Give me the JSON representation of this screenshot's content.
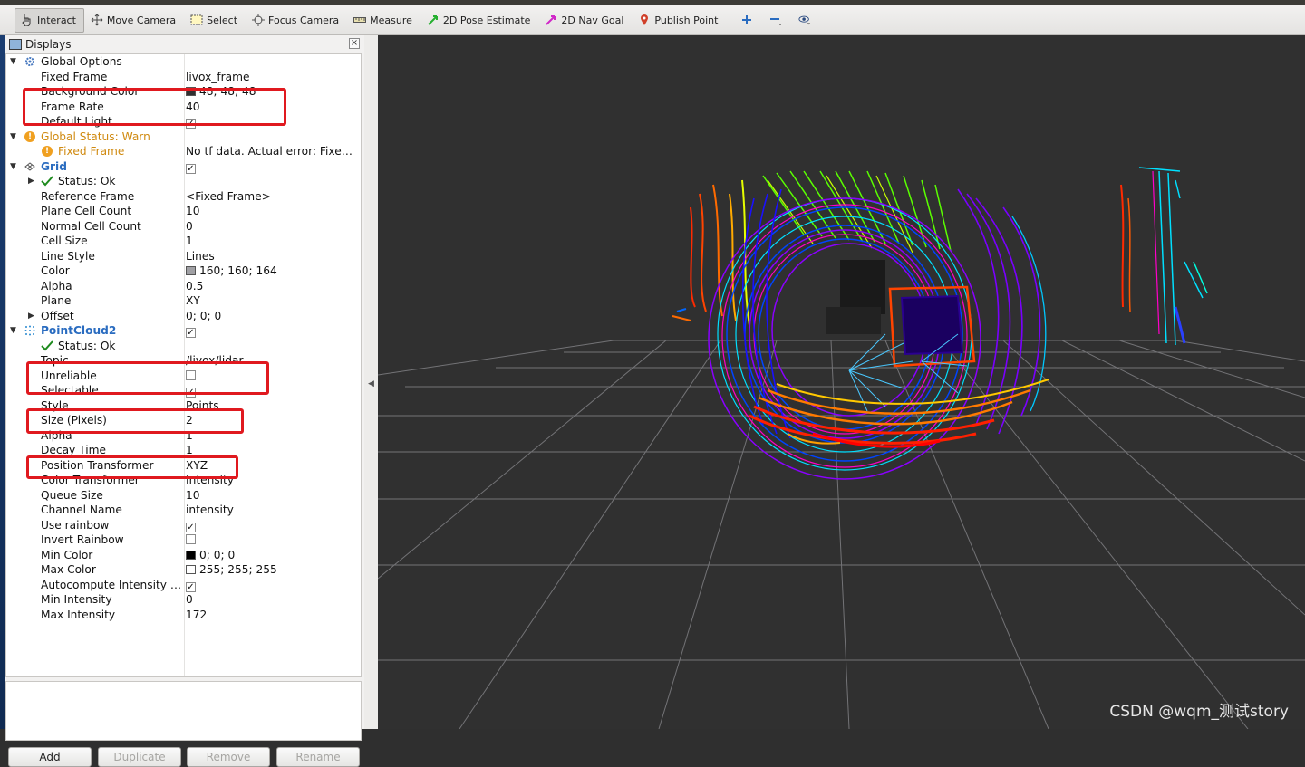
{
  "toolbar": {
    "tools": [
      {
        "label": "Interact",
        "icon": "cursor-hand-icon",
        "active": true
      },
      {
        "label": "Move Camera",
        "icon": "move-camera-icon"
      },
      {
        "label": "Select",
        "icon": "select-box-icon"
      },
      {
        "label": "Focus Camera",
        "icon": "focus-camera-icon"
      },
      {
        "label": "Measure",
        "icon": "ruler-icon"
      },
      {
        "label": "2D Pose Estimate",
        "icon": "green-arrow-icon"
      },
      {
        "label": "2D Nav Goal",
        "icon": "magenta-arrow-icon"
      },
      {
        "label": "Publish Point",
        "icon": "map-pin-icon"
      }
    ],
    "extra_icons": [
      "plus-cross-icon",
      "minus-icon",
      "eye-icon"
    ]
  },
  "displays_panel": {
    "title": "Displays",
    "close": "×"
  },
  "tree": {
    "global_options": {
      "label": "Global Options"
    },
    "fixed_frame": {
      "name": "Fixed Frame",
      "value": "livox_frame"
    },
    "background_color": {
      "name": "Background Color",
      "value": "48; 48; 48",
      "swatch": "#303030"
    },
    "frame_rate": {
      "name": "Frame Rate",
      "value": "40"
    },
    "default_light": {
      "name": "Default Light",
      "checked": "✓"
    },
    "global_status": {
      "label": "Global Status: Warn"
    },
    "gs_fixed_frame": {
      "name": "Fixed Frame",
      "value": "No tf data.  Actual error: Fixe…"
    },
    "grid": {
      "label": "Grid",
      "checked": "✓"
    },
    "grid_status": {
      "name": "Status: Ok"
    },
    "reference_frame": {
      "name": "Reference Frame",
      "value": "<Fixed Frame>"
    },
    "plane_cell_count": {
      "name": "Plane Cell Count",
      "value": "10"
    },
    "normal_cell_count": {
      "name": "Normal Cell Count",
      "value": "0"
    },
    "cell_size": {
      "name": "Cell Size",
      "value": "1"
    },
    "line_style": {
      "name": "Line Style",
      "value": "Lines"
    },
    "color": {
      "name": "Color",
      "value": "160; 160; 164",
      "swatch": "#a0a0a4"
    },
    "alpha": {
      "name": "Alpha",
      "value": "0.5"
    },
    "plane": {
      "name": "Plane",
      "value": "XY"
    },
    "offset": {
      "name": "Offset",
      "value": "0; 0; 0"
    },
    "pointcloud2": {
      "label": "PointCloud2",
      "checked": "✓"
    },
    "pc_status": {
      "name": "Status: Ok"
    },
    "topic": {
      "name": "Topic",
      "value": "/livox/lidar"
    },
    "unreliable": {
      "name": "Unreliable",
      "checked": ""
    },
    "selectable": {
      "name": "Selectable",
      "checked": "✓"
    },
    "style": {
      "name": "Style",
      "value": "Points"
    },
    "size_pixels": {
      "name": "Size (Pixels)",
      "value": "2"
    },
    "pc_alpha": {
      "name": "Alpha",
      "value": "1"
    },
    "decay_time": {
      "name": "Decay Time",
      "value": "1"
    },
    "position_transformer": {
      "name": "Position Transformer",
      "value": "XYZ"
    },
    "color_transformer": {
      "name": "Color Transformer",
      "value": "Intensity"
    },
    "queue_size": {
      "name": "Queue Size",
      "value": "10"
    },
    "channel_name": {
      "name": "Channel Name",
      "value": "intensity"
    },
    "use_rainbow": {
      "name": "Use rainbow",
      "checked": "✓"
    },
    "invert_rainbow": {
      "name": "Invert Rainbow",
      "checked": ""
    },
    "min_color": {
      "name": "Min Color",
      "value": "0; 0; 0",
      "swatch": "#000000"
    },
    "max_color": {
      "name": "Max Color",
      "value": "255; 255; 255",
      "swatch": "#ffffff"
    },
    "autocompute": {
      "name": "Autocompute Intensity …",
      "checked": "✓"
    },
    "min_intensity": {
      "name": "Min Intensity",
      "value": "0"
    },
    "max_intensity": {
      "name": "Max Intensity",
      "value": "172"
    }
  },
  "buttons": {
    "add": "Add",
    "duplicate": "Duplicate",
    "remove": "Remove",
    "rename": "Rename"
  },
  "watermark": "CSDN @wqm_测试story",
  "colors": {
    "highlight": "#e0191f",
    "viewport_bg": "#303030",
    "grid_line": "#a0a0a4"
  }
}
